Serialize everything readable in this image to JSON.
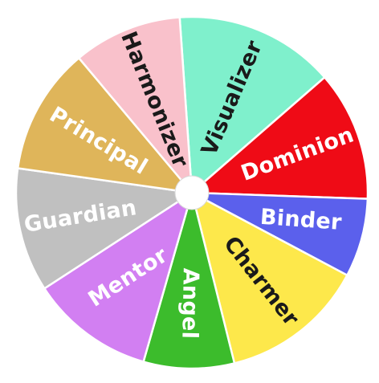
{
  "wheel": {
    "segments": [
      {
        "label": "Visualizer",
        "color": "#7ff0cc",
        "text_color": "#1a1a1a"
      },
      {
        "label": "Dominion",
        "color": "#ef0b16",
        "text_color": "#ffffff"
      },
      {
        "label": "Binder",
        "color": "#5b60ec",
        "text_color": "#ffffff"
      },
      {
        "label": "Charmer",
        "color": "#fde84b",
        "text_color": "#1a1a1a"
      },
      {
        "label": "Angel",
        "color": "#3cbc2c",
        "text_color": "#ffffff"
      },
      {
        "label": "Mentor",
        "color": "#d27ff2",
        "text_color": "#ffffff"
      },
      {
        "label": "Guardian",
        "color": "#c0c0c0",
        "text_color": "#ffffff"
      },
      {
        "label": "Principal",
        "color": "#dfb55a",
        "text_color": "#ffffff"
      },
      {
        "label": "Harmonizer",
        "color": "#f9c1cb",
        "text_color": "#1a1a1a"
      }
    ],
    "hub_color": "#ffffff"
  }
}
